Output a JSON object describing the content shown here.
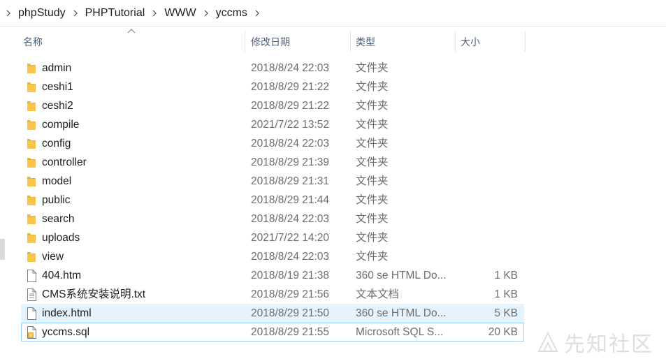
{
  "breadcrumb": [
    "phpStudy",
    "PHPTutorial",
    "WWW",
    "yccms"
  ],
  "columns": {
    "name": "名称",
    "date": "修改日期",
    "type": "类型",
    "size": "大小"
  },
  "files": [
    {
      "name": "admin",
      "date": "2018/8/24 22:03",
      "type": "文件夹",
      "size": "",
      "icon": "folder-icon"
    },
    {
      "name": "ceshi1",
      "date": "2018/8/29 21:22",
      "type": "文件夹",
      "size": "",
      "icon": "folder-icon"
    },
    {
      "name": "ceshi2",
      "date": "2018/8/29 21:22",
      "type": "文件夹",
      "size": "",
      "icon": "folder-icon"
    },
    {
      "name": "compile",
      "date": "2021/7/22 13:52",
      "type": "文件夹",
      "size": "",
      "icon": "folder-icon"
    },
    {
      "name": "config",
      "date": "2018/8/24 22:03",
      "type": "文件夹",
      "size": "",
      "icon": "folder-icon"
    },
    {
      "name": "controller",
      "date": "2018/8/29 21:39",
      "type": "文件夹",
      "size": "",
      "icon": "folder-icon"
    },
    {
      "name": "model",
      "date": "2018/8/29 21:31",
      "type": "文件夹",
      "size": "",
      "icon": "folder-icon"
    },
    {
      "name": "public",
      "date": "2018/8/29 21:44",
      "type": "文件夹",
      "size": "",
      "icon": "folder-icon"
    },
    {
      "name": "search",
      "date": "2018/8/24 22:03",
      "type": "文件夹",
      "size": "",
      "icon": "folder-icon"
    },
    {
      "name": "uploads",
      "date": "2021/7/22 14:20",
      "type": "文件夹",
      "size": "",
      "icon": "folder-icon"
    },
    {
      "name": "view",
      "date": "2018/8/24 22:03",
      "type": "文件夹",
      "size": "",
      "icon": "folder-icon"
    },
    {
      "name": "404.htm",
      "date": "2018/8/19 21:38",
      "type": "360 se HTML Do...",
      "size": "1 KB",
      "icon": "html-file-icon"
    },
    {
      "name": "CMS系统安装说明.txt",
      "date": "2018/8/29 21:56",
      "type": "文本文档",
      "size": "1 KB",
      "icon": "text-file-icon"
    },
    {
      "name": "index.html",
      "date": "2018/8/29 21:50",
      "type": "360 se HTML Do...",
      "size": "5 KB",
      "icon": "html-file-icon",
      "state": "hover"
    },
    {
      "name": "yccms.sql",
      "date": "2018/8/29 21:55",
      "type": "Microsoft SQL S...",
      "size": "20 KB",
      "icon": "sql-file-icon",
      "state": "focused"
    }
  ],
  "watermark": "先知社区",
  "colors": {
    "folder": "#f8c549",
    "hover_bg": "#e5f3ff",
    "focus_border": "#99d1ff",
    "header_text": "#4c607a"
  }
}
